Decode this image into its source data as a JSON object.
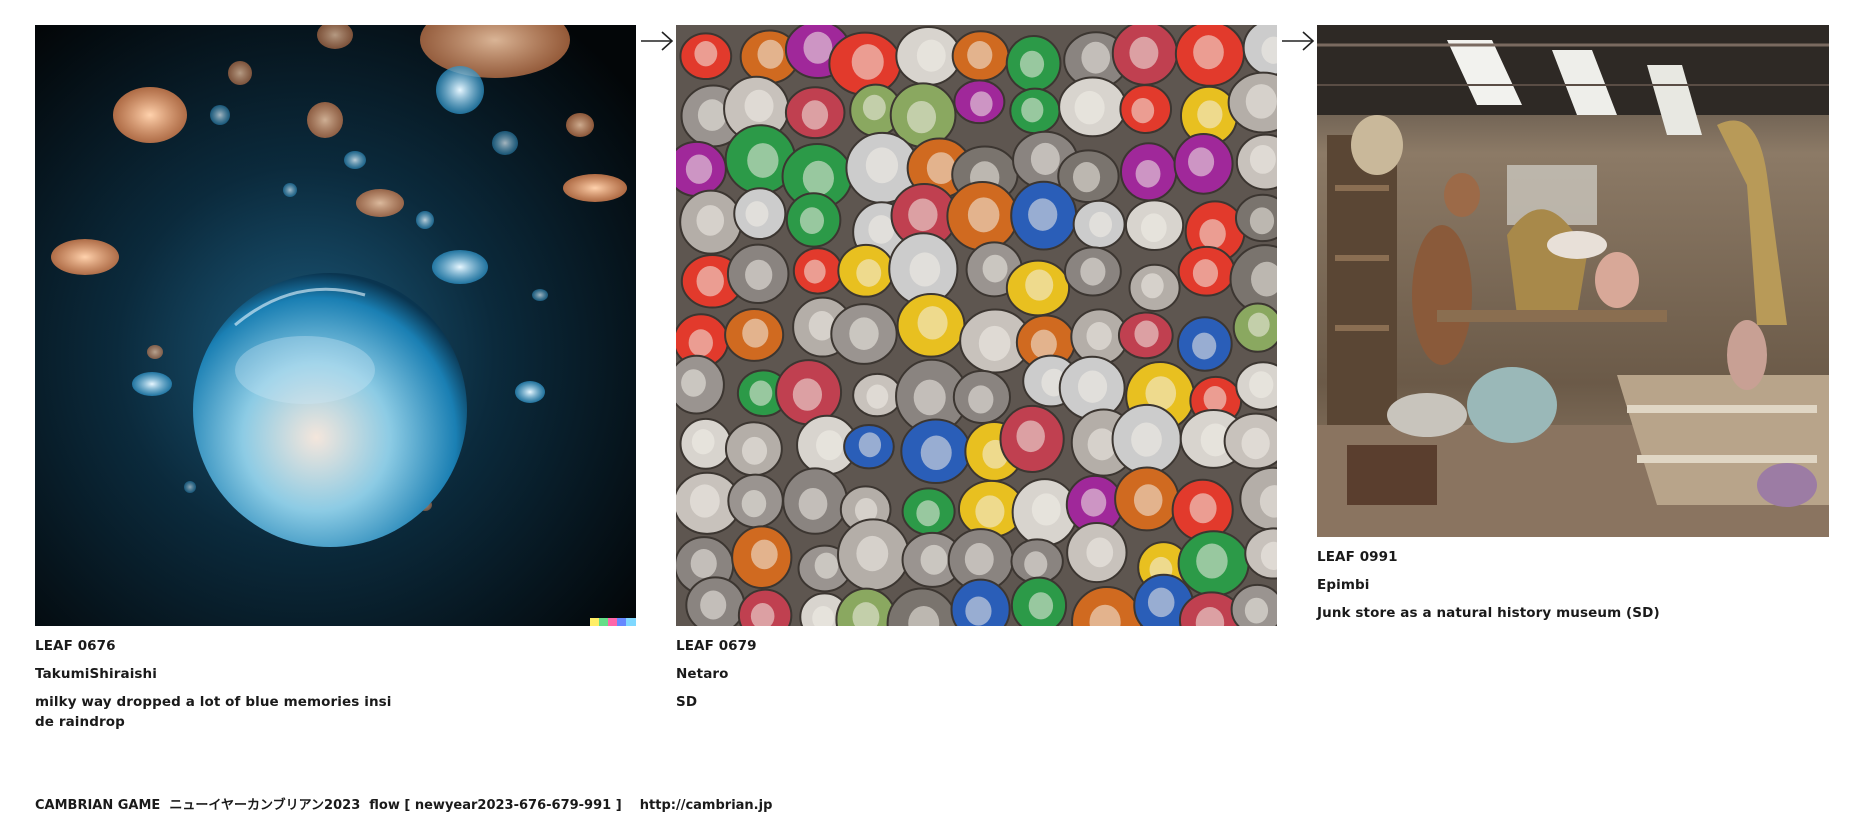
{
  "leaves": [
    {
      "id": "LEAF 0676",
      "author": "TakumiShiraishi",
      "prompt": "milky way dropped a lot of blue memories inside raindrop"
    },
    {
      "id": "LEAF 0679",
      "author": "Netaro",
      "prompt": "SD"
    },
    {
      "id": "LEAF 0991",
      "author": "Epimbi",
      "prompt": "Junk store as a natural history museum (SD)"
    }
  ],
  "footer": {
    "text": "CAMBRIAN GAME  ニューイヤーカンブリアン2023  flow [ newyear2023-676-679-991 ]    http://cambrian.jp"
  },
  "colors": {
    "raindrop_bg": "#07141c",
    "raindrop_blue": "#2a8fc0",
    "raindrop_orange": "#f0a676",
    "coins_bg": "#5e5650",
    "museum_bg": "#6b5a48"
  },
  "icons": {
    "arrow": "arrow-right-icon"
  }
}
